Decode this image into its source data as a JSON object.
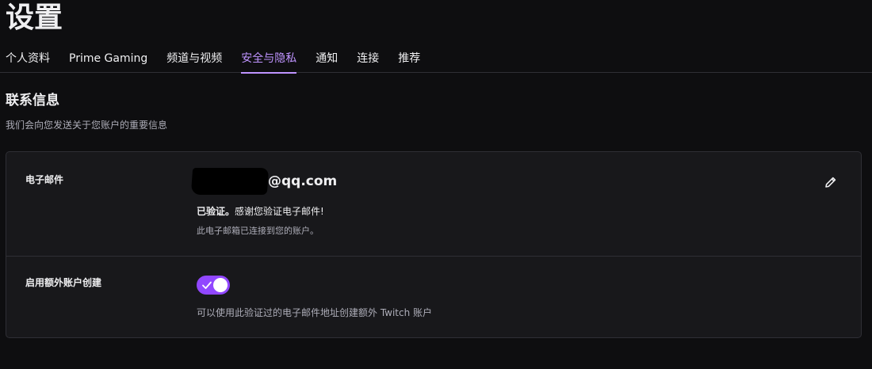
{
  "page": {
    "title": "设置"
  },
  "tabs": [
    {
      "label": "个人资料",
      "active": false
    },
    {
      "label": "Prime Gaming",
      "active": false
    },
    {
      "label": "频道与视频",
      "active": false
    },
    {
      "label": "安全与隐私",
      "active": true
    },
    {
      "label": "通知",
      "active": false
    },
    {
      "label": "连接",
      "active": false
    },
    {
      "label": "推荐",
      "active": false
    }
  ],
  "contact": {
    "title": "联系信息",
    "subtitle": "我们会向您发送关于您账户的重要信息",
    "email": {
      "label": "电子邮件",
      "value": "@qq.com",
      "verified_bold": "已验证。",
      "verified_text": "感谢您验证电子邮件!",
      "connected_text": "此电子邮箱已连接到您的账户。",
      "edit_icon": "pencil-icon"
    },
    "extra_accounts": {
      "label": "启用额外账户创建",
      "enabled": true,
      "description": "可以使用此验证过的电子邮件地址创建额外 Twitch 账户"
    }
  },
  "colors": {
    "accent": "#bf94ff",
    "toggle": "#9147ff",
    "background": "#0e0e10",
    "card": "#18181b"
  }
}
